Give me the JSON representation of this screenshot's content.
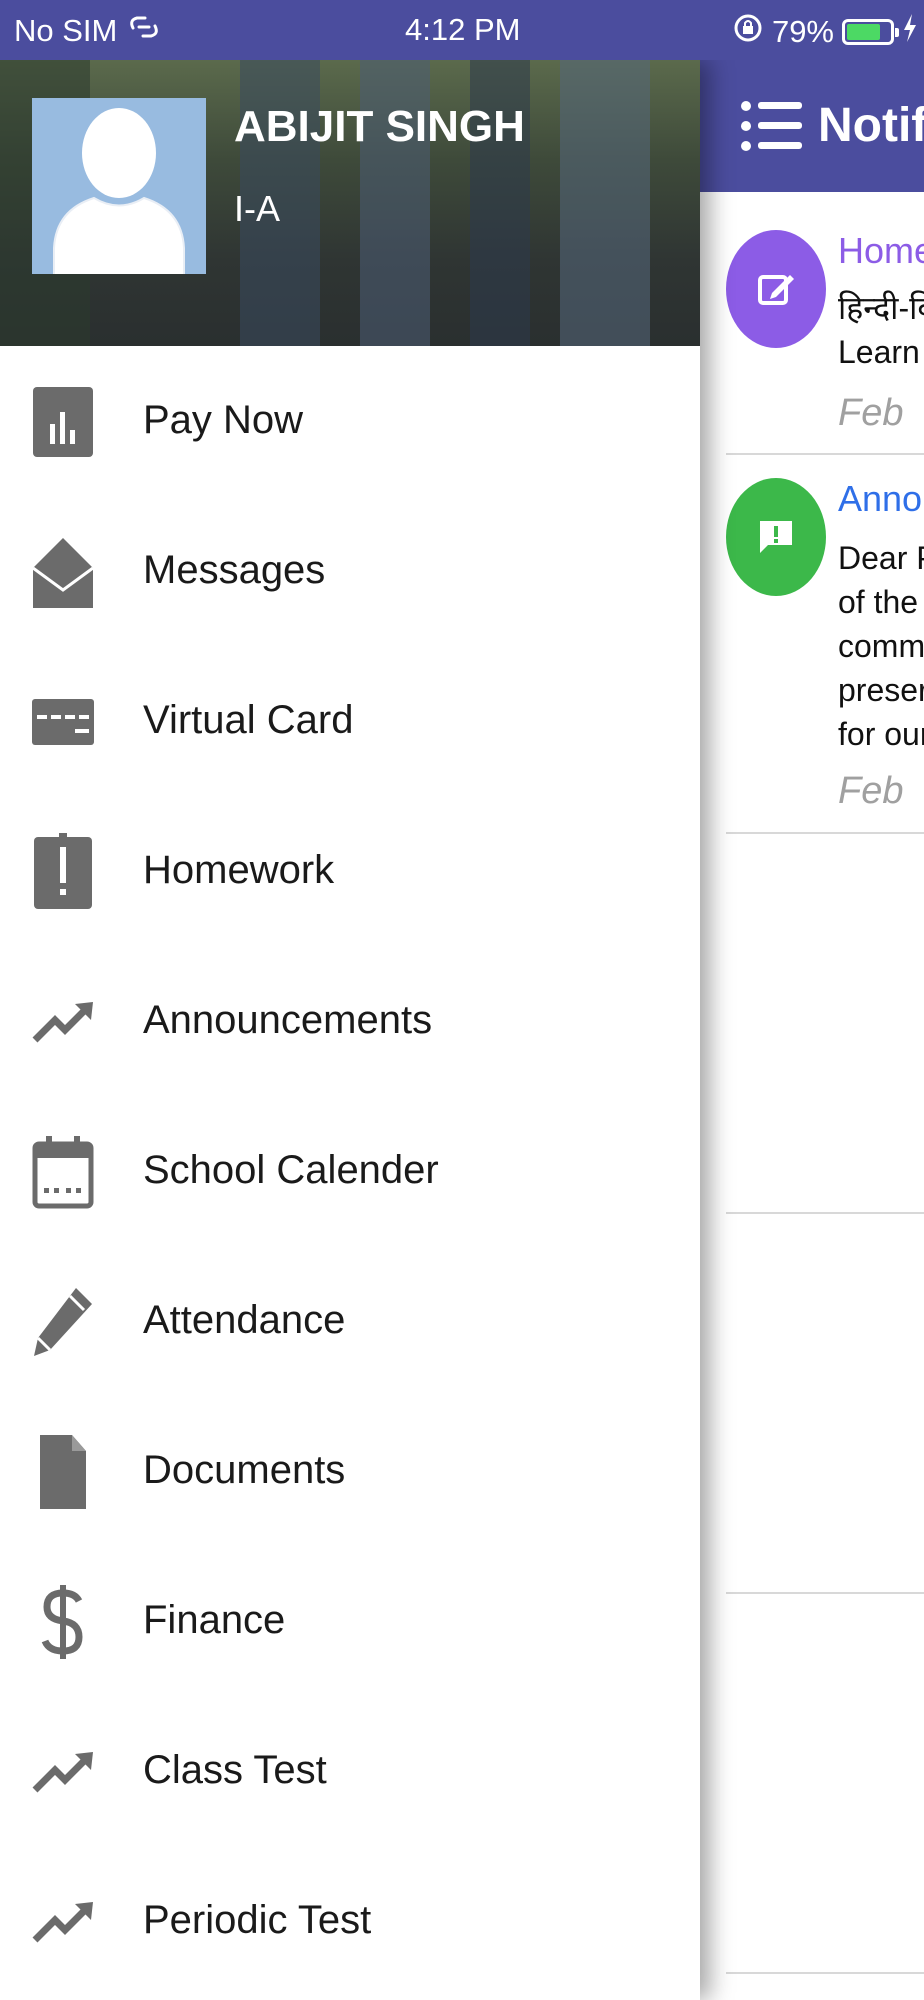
{
  "status_bar": {
    "carrier": "No SIM",
    "time": "4:12 PM",
    "battery": "79%",
    "battery_level": 0.79,
    "colors": {
      "bar": "#4b4d9e",
      "battery_fill": "#4cd964"
    }
  },
  "profile": {
    "name": "ABIJIT SINGH",
    "class": "I-A"
  },
  "menu": {
    "items": [
      {
        "label": "Pay Now",
        "icon": "bar-chart-icon"
      },
      {
        "label": "Messages",
        "icon": "envelope-open-icon"
      },
      {
        "label": "Virtual Card",
        "icon": "card-icon"
      },
      {
        "label": "Homework",
        "icon": "exclamation-clipboard-icon"
      },
      {
        "label": "Announcements",
        "icon": "trending-up-icon"
      },
      {
        "label": "School Calender",
        "icon": "calendar-icon"
      },
      {
        "label": "Attendance",
        "icon": "pencil-icon"
      },
      {
        "label": "Documents",
        "icon": "document-icon"
      },
      {
        "label": "Finance",
        "icon": "dollar-icon"
      },
      {
        "label": "Class Test",
        "icon": "trending-up-icon"
      },
      {
        "label": "Periodic Test",
        "icon": "trending-up-icon"
      }
    ]
  },
  "background_screen": {
    "title": "Notifi",
    "notifications": [
      {
        "title": "Home",
        "lines": [
          "हिन्दी-वि",
          "Learn "
        ],
        "date": "Feb",
        "color": "#8c5ce6",
        "title_color": "#8c5ce6",
        "icon": "edit-icon"
      },
      {
        "title": "Annou",
        "lines": [
          "Dear P",
          "of the ",
          "comm",
          "preser",
          "for our"
        ],
        "date": "Feb",
        "color": "#3cb84a",
        "title_color": "#2f6fe8",
        "icon": "alert-message-icon"
      }
    ]
  }
}
